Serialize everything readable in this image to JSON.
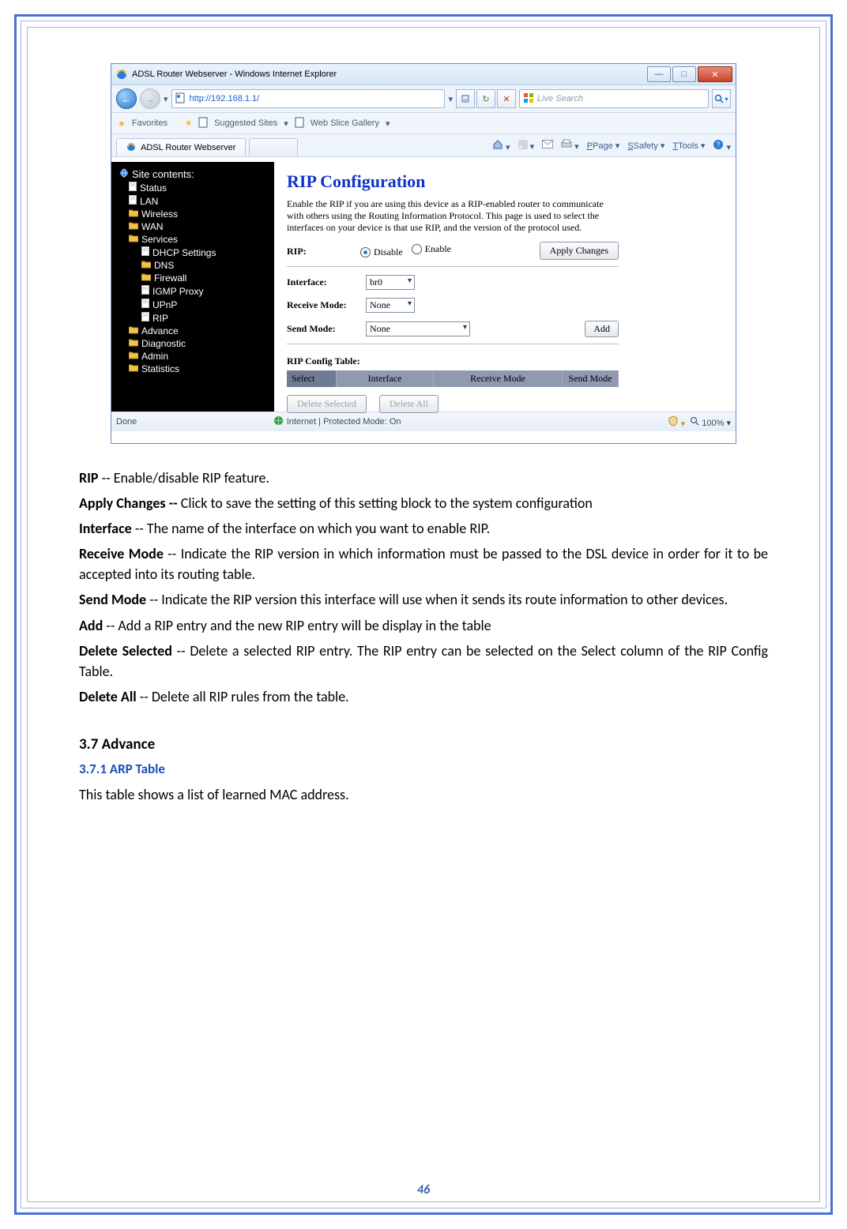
{
  "browser": {
    "window_title": "ADSL Router Webserver - Windows Internet Explorer",
    "url": "http://192.168.1.1/",
    "search_placeholder": "Live Search",
    "favorites_label": "Favorites",
    "suggested_sites": "Suggested Sites",
    "web_slice": "Web Slice Gallery",
    "tab_title": "ADSL Router Webserver",
    "menus": {
      "page": "Page",
      "safety": "Safety",
      "tools": "Tools"
    },
    "status_left": "Done",
    "status_center": "Internet | Protected Mode: On",
    "zoom": "100%"
  },
  "sidebar": {
    "title": "Site contents:",
    "items": [
      {
        "label": "Status",
        "lvl": 1,
        "ico": "doc"
      },
      {
        "label": "LAN",
        "lvl": 1,
        "ico": "doc"
      },
      {
        "label": "Wireless",
        "lvl": 1,
        "ico": "fold"
      },
      {
        "label": "WAN",
        "lvl": 1,
        "ico": "fold"
      },
      {
        "label": "Services",
        "lvl": 1,
        "ico": "fold"
      },
      {
        "label": "DHCP Settings",
        "lvl": 2,
        "ico": "doc"
      },
      {
        "label": "DNS",
        "lvl": 2,
        "ico": "fold"
      },
      {
        "label": "Firewall",
        "lvl": 2,
        "ico": "fold"
      },
      {
        "label": "IGMP Proxy",
        "lvl": 2,
        "ico": "doc"
      },
      {
        "label": "UPnP",
        "lvl": 2,
        "ico": "doc"
      },
      {
        "label": "RIP",
        "lvl": 2,
        "ico": "doc"
      },
      {
        "label": "Advance",
        "lvl": 1,
        "ico": "fold"
      },
      {
        "label": "Diagnostic",
        "lvl": 1,
        "ico": "fold"
      },
      {
        "label": "Admin",
        "lvl": 1,
        "ico": "fold"
      },
      {
        "label": "Statistics",
        "lvl": 1,
        "ico": "fold"
      }
    ]
  },
  "main": {
    "title": "RIP Configuration",
    "desc": "Enable the RIP if you are using this device as a RIP-enabled router to communicate with others using the Routing Information Protocol. This page is used to select the interfaces on your device is that use RIP, and the version of the protocol used.",
    "rip_label": "RIP:",
    "disable": "Disable",
    "enable": "Enable",
    "apply": "Apply Changes",
    "interface_label": "Interface:",
    "interface_value": "br0",
    "recv_label": "Receive Mode:",
    "recv_value": "None",
    "send_label": "Send Mode:",
    "send_value": "None",
    "add": "Add",
    "table_title": "RIP Config Table:",
    "cols": {
      "select": "Select",
      "interface": "Interface",
      "recv": "Receive Mode",
      "send": "Send Mode"
    },
    "delete_selected": "Delete Selected",
    "delete_all": "Delete All"
  },
  "doc": {
    "p1a": "RIP",
    "p1b": " -- Enable/disable RIP feature.",
    "p2a": "Apply Changes --",
    "p2b": " Click to save the setting of this setting block to the system configuration",
    "p3a": "Interface",
    "p3b": " -- The name of the interface on which you want to enable RIP.",
    "p4a": "Receive Mode",
    "p4b": " -- Indicate the RIP version in which information must be passed to the DSL device in order for it to be accepted into its routing table.",
    "p5a": "Send Mode",
    "p5b": " -- Indicate the RIP version this interface will use when it sends its route information to other devices.",
    "p6a": "Add",
    "p6b": " -- Add a RIP entry and the new RIP entry will be display in the table",
    "p7a": "Delete Selected",
    "p7b": " -- Delete a selected RIP entry. The RIP entry can be selected on the Select column of the RIP Config Table.",
    "p8a": "Delete All",
    "p8b": " -- Delete all RIP rules from the table.",
    "sec": "3.7 Advance",
    "sub": "3.7.1 ARP Table",
    "sub_desc": "This table shows a list of learned MAC address."
  },
  "page_number": "46"
}
